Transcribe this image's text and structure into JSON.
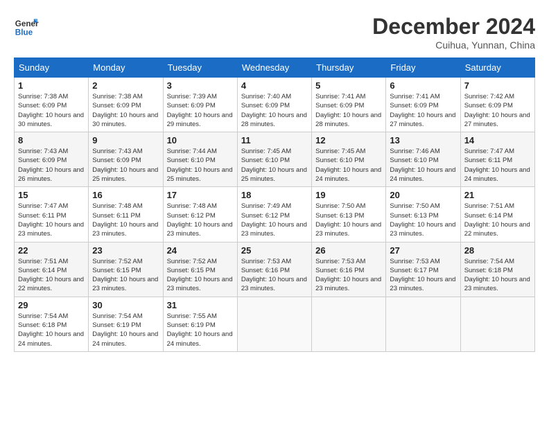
{
  "logo": {
    "line1": "General",
    "line2": "Blue"
  },
  "header": {
    "month": "December 2024",
    "location": "Cuihua, Yunnan, China"
  },
  "weekdays": [
    "Sunday",
    "Monday",
    "Tuesday",
    "Wednesday",
    "Thursday",
    "Friday",
    "Saturday"
  ],
  "weeks": [
    [
      {
        "day": "1",
        "sunrise": "7:38 AM",
        "sunset": "6:09 PM",
        "daylight": "10 hours and 30 minutes."
      },
      {
        "day": "2",
        "sunrise": "7:38 AM",
        "sunset": "6:09 PM",
        "daylight": "10 hours and 30 minutes."
      },
      {
        "day": "3",
        "sunrise": "7:39 AM",
        "sunset": "6:09 PM",
        "daylight": "10 hours and 29 minutes."
      },
      {
        "day": "4",
        "sunrise": "7:40 AM",
        "sunset": "6:09 PM",
        "daylight": "10 hours and 28 minutes."
      },
      {
        "day": "5",
        "sunrise": "7:41 AM",
        "sunset": "6:09 PM",
        "daylight": "10 hours and 28 minutes."
      },
      {
        "day": "6",
        "sunrise": "7:41 AM",
        "sunset": "6:09 PM",
        "daylight": "10 hours and 27 minutes."
      },
      {
        "day": "7",
        "sunrise": "7:42 AM",
        "sunset": "6:09 PM",
        "daylight": "10 hours and 27 minutes."
      }
    ],
    [
      {
        "day": "8",
        "sunrise": "7:43 AM",
        "sunset": "6:09 PM",
        "daylight": "10 hours and 26 minutes."
      },
      {
        "day": "9",
        "sunrise": "7:43 AM",
        "sunset": "6:09 PM",
        "daylight": "10 hours and 25 minutes."
      },
      {
        "day": "10",
        "sunrise": "7:44 AM",
        "sunset": "6:10 PM",
        "daylight": "10 hours and 25 minutes."
      },
      {
        "day": "11",
        "sunrise": "7:45 AM",
        "sunset": "6:10 PM",
        "daylight": "10 hours and 25 minutes."
      },
      {
        "day": "12",
        "sunrise": "7:45 AM",
        "sunset": "6:10 PM",
        "daylight": "10 hours and 24 minutes."
      },
      {
        "day": "13",
        "sunrise": "7:46 AM",
        "sunset": "6:10 PM",
        "daylight": "10 hours and 24 minutes."
      },
      {
        "day": "14",
        "sunrise": "7:47 AM",
        "sunset": "6:11 PM",
        "daylight": "10 hours and 24 minutes."
      }
    ],
    [
      {
        "day": "15",
        "sunrise": "7:47 AM",
        "sunset": "6:11 PM",
        "daylight": "10 hours and 23 minutes."
      },
      {
        "day": "16",
        "sunrise": "7:48 AM",
        "sunset": "6:11 PM",
        "daylight": "10 hours and 23 minutes."
      },
      {
        "day": "17",
        "sunrise": "7:48 AM",
        "sunset": "6:12 PM",
        "daylight": "10 hours and 23 minutes."
      },
      {
        "day": "18",
        "sunrise": "7:49 AM",
        "sunset": "6:12 PM",
        "daylight": "10 hours and 23 minutes."
      },
      {
        "day": "19",
        "sunrise": "7:50 AM",
        "sunset": "6:13 PM",
        "daylight": "10 hours and 23 minutes."
      },
      {
        "day": "20",
        "sunrise": "7:50 AM",
        "sunset": "6:13 PM",
        "daylight": "10 hours and 23 minutes."
      },
      {
        "day": "21",
        "sunrise": "7:51 AM",
        "sunset": "6:14 PM",
        "daylight": "10 hours and 22 minutes."
      }
    ],
    [
      {
        "day": "22",
        "sunrise": "7:51 AM",
        "sunset": "6:14 PM",
        "daylight": "10 hours and 22 minutes."
      },
      {
        "day": "23",
        "sunrise": "7:52 AM",
        "sunset": "6:15 PM",
        "daylight": "10 hours and 23 minutes."
      },
      {
        "day": "24",
        "sunrise": "7:52 AM",
        "sunset": "6:15 PM",
        "daylight": "10 hours and 23 minutes."
      },
      {
        "day": "25",
        "sunrise": "7:53 AM",
        "sunset": "6:16 PM",
        "daylight": "10 hours and 23 minutes."
      },
      {
        "day": "26",
        "sunrise": "7:53 AM",
        "sunset": "6:16 PM",
        "daylight": "10 hours and 23 minutes."
      },
      {
        "day": "27",
        "sunrise": "7:53 AM",
        "sunset": "6:17 PM",
        "daylight": "10 hours and 23 minutes."
      },
      {
        "day": "28",
        "sunrise": "7:54 AM",
        "sunset": "6:18 PM",
        "daylight": "10 hours and 23 minutes."
      }
    ],
    [
      {
        "day": "29",
        "sunrise": "7:54 AM",
        "sunset": "6:18 PM",
        "daylight": "10 hours and 24 minutes."
      },
      {
        "day": "30",
        "sunrise": "7:54 AM",
        "sunset": "6:19 PM",
        "daylight": "10 hours and 24 minutes."
      },
      {
        "day": "31",
        "sunrise": "7:55 AM",
        "sunset": "6:19 PM",
        "daylight": "10 hours and 24 minutes."
      },
      null,
      null,
      null,
      null
    ]
  ]
}
